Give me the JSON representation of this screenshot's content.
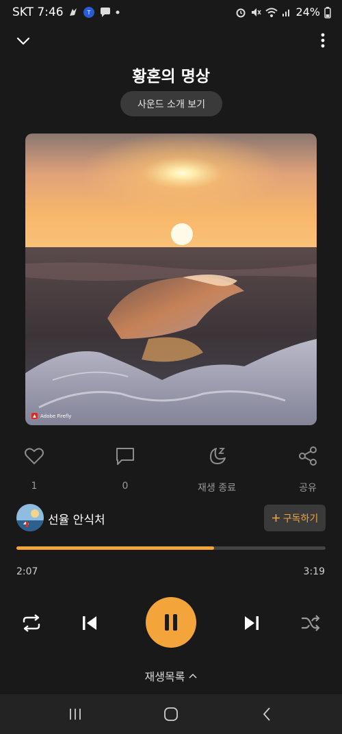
{
  "status_bar": {
    "carrier_time": "SKT 7:46",
    "battery": "24%",
    "icons": [
      "notification-icon",
      "alarm-icon",
      "mute-icon",
      "wifi-icon",
      "signal-icon"
    ]
  },
  "header": {
    "title": "황혼의 명상",
    "sound_intro_label": "사운드 소개 보기"
  },
  "artwork": {
    "credit": "Adobe Firefly"
  },
  "actions": {
    "like_count": "1",
    "comment_count": "0",
    "sleep_timer_label": "재생 종료",
    "share_label": "공유"
  },
  "channel": {
    "name": "선율 안식처",
    "subscribe_label": "구독하기"
  },
  "player": {
    "elapsed": "2:07",
    "total": "3:19",
    "progress": 0.64,
    "accent_color": "#f3a53b"
  },
  "playlist": {
    "label": "재생목록"
  }
}
